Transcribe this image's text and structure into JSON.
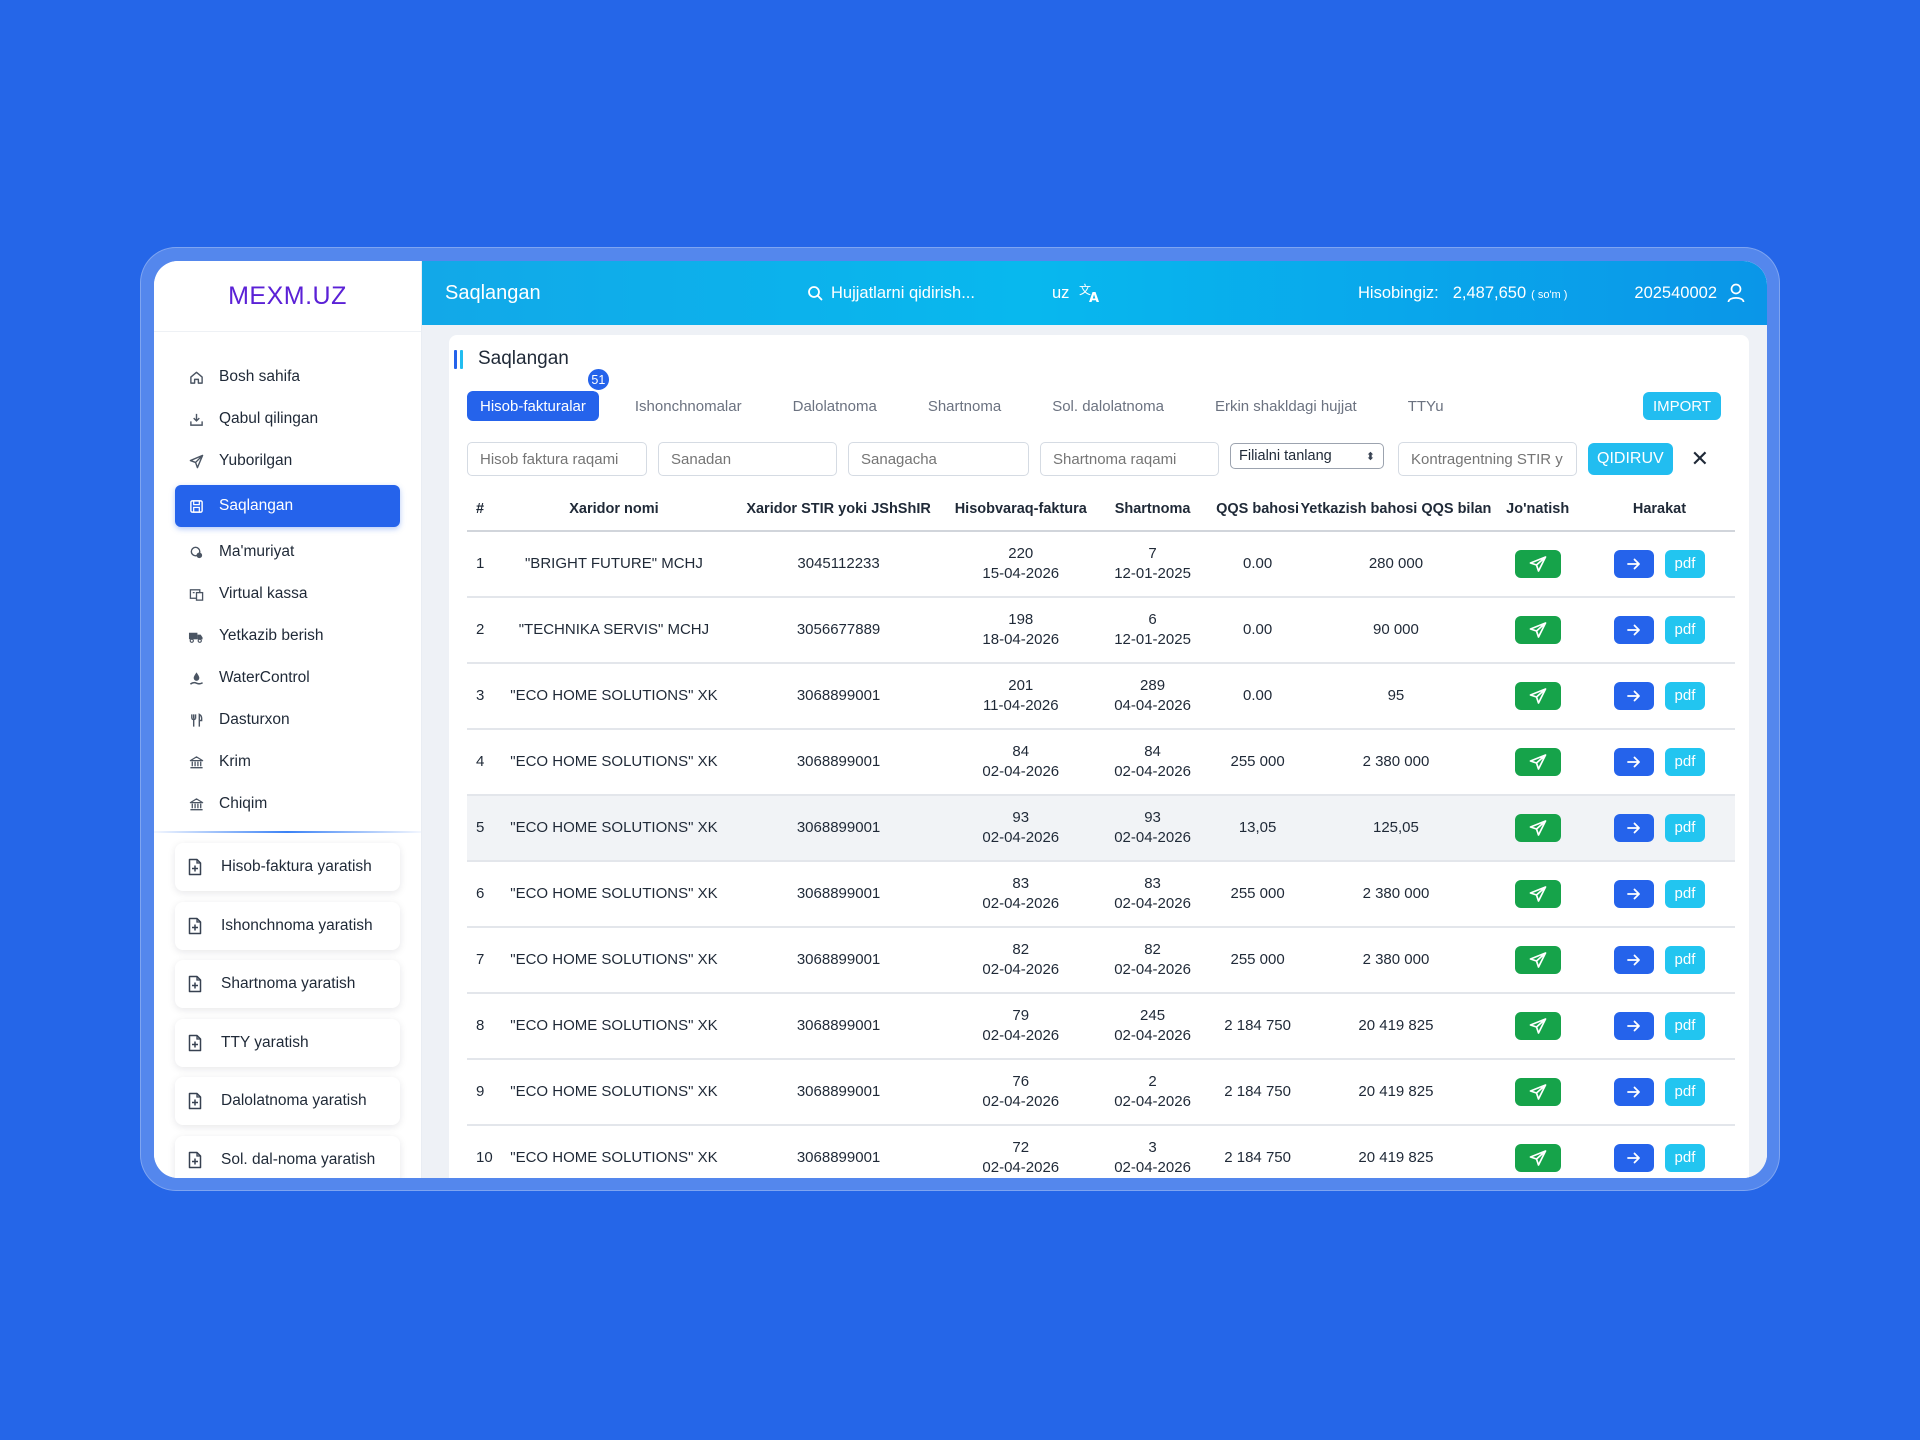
{
  "app": {
    "logo": "MEXM.UZ"
  },
  "topbar": {
    "page_title": "Saqlangan",
    "search_label": "Hujjatlarni qidirish...",
    "lang": "uz",
    "balance_label": "Hisobingiz:",
    "balance_amount": "2,487,650",
    "balance_currency": "( so'm )",
    "user_id": "202540002"
  },
  "sidebar": {
    "items": [
      {
        "label": "Bosh sahifa",
        "icon": "home-icon"
      },
      {
        "label": "Qabul qilingan",
        "icon": "inbox-icon"
      },
      {
        "label": "Yuborilgan",
        "icon": "send-icon"
      },
      {
        "label": "Saqlangan",
        "icon": "save-icon",
        "active": true
      },
      {
        "label": "Ma'muriyat",
        "icon": "admin-icon"
      },
      {
        "label": "Virtual kassa",
        "icon": "cash-register-icon"
      },
      {
        "label": "Yetkazib berish",
        "icon": "truck-icon"
      },
      {
        "label": "WaterControl",
        "icon": "water-icon"
      },
      {
        "label": "Dasturxon",
        "icon": "utensils-icon"
      },
      {
        "label": "Krim",
        "icon": "bank-icon"
      },
      {
        "label": "Chiqim",
        "icon": "bank-icon"
      }
    ],
    "create_buttons": [
      "Hisob-faktura yaratish",
      "Ishonchnoma yaratish",
      "Shartnoma yaratish",
      "TTY yaratish",
      "Dalolatnoma yaratish",
      "Sol. dal-noma yaratish"
    ]
  },
  "section": {
    "title": "Saqlangan"
  },
  "tabs": [
    {
      "label": "Hisob-fakturalar",
      "badge": "51",
      "active": true
    },
    {
      "label": "Ishonchnomalar"
    },
    {
      "label": "Dalolatnoma"
    },
    {
      "label": "Shartnoma"
    },
    {
      "label": "Sol. dalolatnoma"
    },
    {
      "label": "Erkin shakldagi hujjat"
    },
    {
      "label": "TTYu"
    }
  ],
  "import_label": "IMPORT",
  "filters": {
    "invoice_number_placeholder": "Hisob faktura raqami",
    "date_from_placeholder": "Sanadan",
    "date_to_placeholder": "Sanagacha",
    "contract_number_placeholder": "Shartnoma raqami",
    "branch_select_value": "Filialni tanlang",
    "counterparty_placeholder": "Kontragentning STIR y",
    "search_button": "QIDIRUV",
    "clear": "✕"
  },
  "table": {
    "columns": [
      "#",
      "Xaridor nomi",
      "Xaridor STIR yoki JShShIR",
      "Hisobvaraq-faktura",
      "Shartnoma",
      "QQS bahosi",
      "Yetkazish bahosi QQS bilan",
      "Jo'natish",
      "Harakat"
    ],
    "pdf_label": "pdf",
    "rows": [
      {
        "n": "1",
        "buyer": "\"BRIGHT FUTURE\" MCHJ",
        "stir": "3045112233",
        "inv_no": "220",
        "inv_date": "15-04-2026",
        "con_no": "7",
        "con_date": "12-01-2025",
        "vat": "0.00",
        "total": "280 000"
      },
      {
        "n": "2",
        "buyer": "\"TECHNIKA SERVIS\" MCHJ",
        "stir": "3056677889",
        "inv_no": "198",
        "inv_date": "18-04-2026",
        "con_no": "6",
        "con_date": "12-01-2025",
        "vat": "0.00",
        "total": "90 000"
      },
      {
        "n": "3",
        "buyer": "\"ECO HOME SOLUTIONS\" XK",
        "stir": "3068899001",
        "inv_no": "201",
        "inv_date": "11-04-2026",
        "con_no": "289",
        "con_date": "04-04-2026",
        "vat": "0.00",
        "total": "95"
      },
      {
        "n": "4",
        "buyer": "\"ECO HOME SOLUTIONS\" XK",
        "stir": "3068899001",
        "inv_no": "84",
        "inv_date": "02-04-2026",
        "con_no": "84",
        "con_date": "02-04-2026",
        "vat": "255 000",
        "total": "2 380 000"
      },
      {
        "n": "5",
        "buyer": "\"ECO HOME SOLUTIONS\" XK",
        "stir": "3068899001",
        "inv_no": "93",
        "inv_date": "02-04-2026",
        "con_no": "93",
        "con_date": "02-04-2026",
        "vat": "13,05",
        "total": "125,05",
        "highlight": true
      },
      {
        "n": "6",
        "buyer": "\"ECO HOME SOLUTIONS\" XK",
        "stir": "3068899001",
        "inv_no": "83",
        "inv_date": "02-04-2026",
        "con_no": "83",
        "con_date": "02-04-2026",
        "vat": "255 000",
        "total": "2 380 000"
      },
      {
        "n": "7",
        "buyer": "\"ECO HOME SOLUTIONS\" XK",
        "stir": "3068899001",
        "inv_no": "82",
        "inv_date": "02-04-2026",
        "con_no": "82",
        "con_date": "02-04-2026",
        "vat": "255 000",
        "total": "2 380 000"
      },
      {
        "n": "8",
        "buyer": "\"ECO HOME SOLUTIONS\" XK",
        "stir": "3068899001",
        "inv_no": "79",
        "inv_date": "02-04-2026",
        "con_no": "245",
        "con_date": "02-04-2026",
        "vat": "2 184 750",
        "total": "20 419 825"
      },
      {
        "n": "9",
        "buyer": "\"ECO HOME SOLUTIONS\" XK",
        "stir": "3068899001",
        "inv_no": "76",
        "inv_date": "02-04-2026",
        "con_no": "2",
        "con_date": "02-04-2026",
        "vat": "2 184 750",
        "total": "20 419 825"
      },
      {
        "n": "10",
        "buyer": "\"ECO HOME SOLUTIONS\" XK",
        "stir": "3068899001",
        "inv_no": "72",
        "inv_date": "02-04-2026",
        "con_no": "3",
        "con_date": "02-04-2026",
        "vat": "2 184 750",
        "total": "20 419 825"
      }
    ]
  },
  "colors": {
    "background": "#2566e8",
    "primary": "#2563eb",
    "accent_cyan": "#22bdf0",
    "send_green": "#16a34a",
    "logo_purple": "#5b21d6"
  }
}
